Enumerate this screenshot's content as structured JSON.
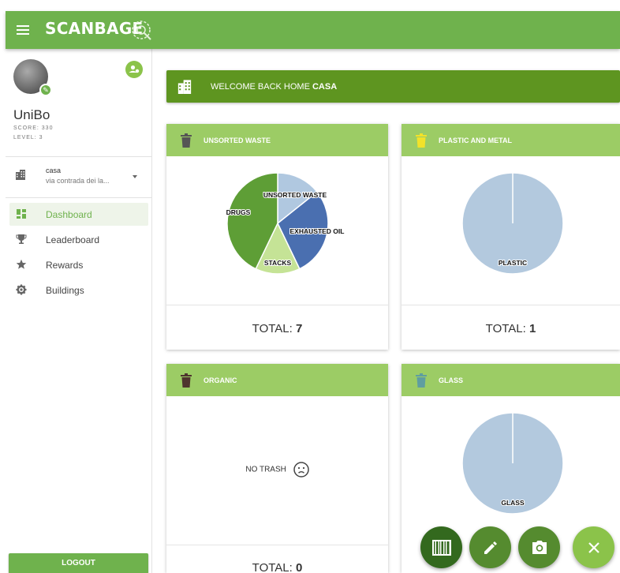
{
  "app": {
    "brand": "SCANBAGE"
  },
  "user": {
    "name": "UniBo",
    "score": "SCORE: 330",
    "level": "LEVEL: 3"
  },
  "building": {
    "name": "casa",
    "address": "via contrada dei la..."
  },
  "nav": [
    {
      "label": "Dashboard",
      "icon": "dashboard-icon",
      "active": true
    },
    {
      "label": "Leaderboard",
      "icon": "trophy-icon",
      "active": false
    },
    {
      "label": "Rewards",
      "icon": "star-icon",
      "active": false
    },
    {
      "label": "Buildings",
      "icon": "gear-icon",
      "active": false
    }
  ],
  "logout_label": "LOGOUT",
  "welcome": {
    "prefix": "WELCOME BACK HOME ",
    "home": "CASA"
  },
  "cards": [
    {
      "title": "UNSORTED WASTE",
      "bin_color": "#555555",
      "total_label": "TOTAL: ",
      "total_value": "7"
    },
    {
      "title": "PLASTIC AND METAL",
      "bin_color": "#f2e22a",
      "total_label": "TOTAL: ",
      "total_value": "1"
    },
    {
      "title": "ORGANIC",
      "bin_color": "#4e342e",
      "empty_text": "NO TRASH",
      "total_label": "TOTAL: ",
      "total_value": "0"
    },
    {
      "title": "GLASS",
      "bin_color": "#5f9ea0"
    }
  ],
  "colors": {
    "primary": "#6fb24d",
    "card_header": "#9ccc65",
    "welcome": "#5e9520",
    "fab_dark": "#33691e",
    "fab_mid": "#558b2f",
    "fab_close": "#8bc34a"
  },
  "chart_data": [
    {
      "type": "pie",
      "series": [
        {
          "values": [
            1,
            2,
            1,
            3
          ]
        }
      ],
      "categories": [
        "UNSORTED WASTE",
        "EXHAUSTED OIL",
        "STACKS",
        "DRUGS"
      ],
      "colors": [
        "#b0c8e0",
        "#4a6fb0",
        "#c5e396",
        "#5e9e36"
      ]
    },
    {
      "type": "pie",
      "series": [
        {
          "values": [
            1
          ]
        }
      ],
      "categories": [
        "PLASTIC"
      ],
      "colors": [
        "#b3c9de"
      ]
    },
    {
      "type": "pie",
      "series": [
        {
          "values": [
            1
          ]
        }
      ],
      "categories": [
        "GLASS"
      ],
      "colors": [
        "#b3c9de"
      ]
    }
  ]
}
